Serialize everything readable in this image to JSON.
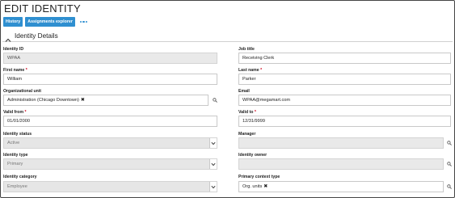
{
  "page": {
    "title": "EDIT IDENTITY"
  },
  "toolbar": {
    "history_label": "History",
    "assignments_label": "Assignments explorer"
  },
  "section": {
    "title": "Identity Details"
  },
  "fields": {
    "identity_id": {
      "label": "Identity ID",
      "value": "WPAA"
    },
    "job_title": {
      "label": "Job title",
      "value": "Receiving Clerk"
    },
    "first_name": {
      "label": "First name",
      "value": "William",
      "required": "*"
    },
    "last_name": {
      "label": "Last name",
      "value": "Parker",
      "required": "*"
    },
    "org_unit": {
      "label": "Organizational unit",
      "value": "Administration (Chicago Downtown)"
    },
    "email": {
      "label": "Email",
      "value": "WPAA@megamart.com"
    },
    "valid_from": {
      "label": "Valid from",
      "value": "01/01/2000",
      "required": "*"
    },
    "valid_to": {
      "label": "Valid to",
      "value": "12/31/9999",
      "required": "*"
    },
    "identity_status": {
      "label": "Identity status",
      "value": "Active"
    },
    "manager": {
      "label": "Manager",
      "value": ""
    },
    "identity_type": {
      "label": "Identity type",
      "value": "Primary"
    },
    "identity_owner": {
      "label": "Identity owner",
      "value": ""
    },
    "identity_category": {
      "label": "Identity category",
      "value": "Employee"
    },
    "primary_context_type": {
      "label": "Primary context type",
      "value": "Org. units"
    }
  },
  "icons": {
    "more": "more-horizontal-icon",
    "collapse": "chevron-up-icon",
    "search": "search-icon",
    "dropdown": "chevron-down-icon",
    "remove": "close-icon"
  },
  "colors": {
    "accent": "#2f8fd0",
    "required": "#d0021b",
    "readonly_bg": "#e9e9e9"
  }
}
